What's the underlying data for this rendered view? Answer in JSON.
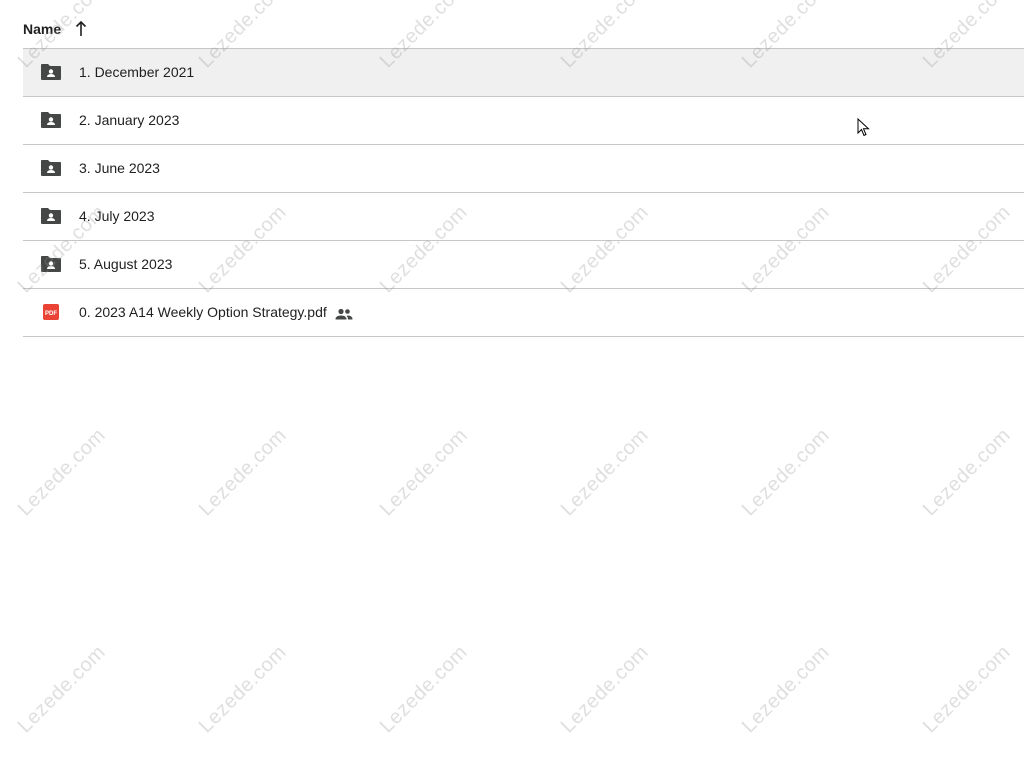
{
  "header": {
    "name_label": "Name",
    "sort_icon": "arrow-up-icon"
  },
  "rows": [
    {
      "label": "1. December 2021",
      "icon": "shared-folder-icon",
      "selected": true
    },
    {
      "label": "2. January 2023",
      "icon": "shared-folder-icon"
    },
    {
      "label": "3. June 2023",
      "icon": "shared-folder-icon"
    },
    {
      "label": "4. July 2023",
      "icon": "shared-folder-icon"
    },
    {
      "label": "5. August 2023",
      "icon": "shared-folder-icon"
    },
    {
      "label": "0. 2023 A14 Weekly Option Strategy.pdf",
      "icon": "pdf-file-icon",
      "shared_indicator": "people-icon"
    }
  ],
  "watermark": "Lezede.com",
  "colors": {
    "selected_row": "#f0f0f0",
    "divider": "#c4c7c5",
    "folder_icon": "#444746",
    "pdf_icon": "#ea4335"
  }
}
